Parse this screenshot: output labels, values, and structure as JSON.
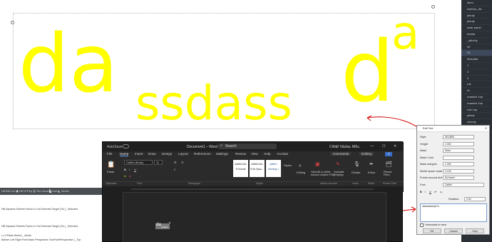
{
  "canvas": {
    "text_da": "da",
    "text_ssdass": "ssdass",
    "text_d": "d",
    "text_a": "a",
    "text_color": "#ffff00",
    "annotation_color": "#d40000"
  },
  "props_panel": {
    "items": [
      "dlom",
      "exterior_div",
      "pleuty",
      "plouty",
      "solar panel",
      "tomba",
      "_alluchy",
      "02",
      "03",
      "lenturkta",
      "1",
      "2",
      "3",
      "ruk",
      "rtt",
      "rmanice 1np",
      "rmanice 2np",
      "rcel 1np",
      "pilmar",
      "schody",
      "strop 1np",
      "strop 2np"
    ]
  },
  "command": {
    "toolbar": "Hill  Mil  Cm  ▣  Htl  Hl  Pep  ▤  Tex  Gsnd  ▙  Knrl  ◣  Vertex",
    "lines": [
      "Hill Dynamic Extents Factor In Out Selected Target (Tol ) _Selected",
      "Hill Dynamic Extents Factor In Out Selected Target (Tol ) _Selected",
      "x ) CPlane World ) _World",
      "Bottom Left Right Front Back Perspective TwoPointPerspective ) _Top"
    ]
  },
  "word": {
    "autosave": "AutoSave",
    "doc_title": "Document1 – Word",
    "search": "Search",
    "user": "Cihlář Václav, MSc.",
    "tabs": [
      "File",
      "Home",
      "Insert",
      "Draw",
      "Design",
      "Layout",
      "References",
      "Mailings",
      "Review",
      "View",
      "Help",
      "Acrobat"
    ],
    "comments": "Comments",
    "editing_mode": "Editing",
    "share": "↗",
    "paste": "Paste",
    "font_name": "Calibri (Body)",
    "font_size": "11",
    "styles": [
      {
        "preview": "AaBbCcDc",
        "name": "¶ Normal"
      },
      {
        "preview": "AaBbCcDc",
        "name": "¶ No Spac..."
      },
      {
        "preview": "AaBbC",
        "name": "Heading 1"
      }
    ],
    "styles_label": "Styles",
    "editing": "Editing",
    "create_pdf": "Vytvořit a sdílet\nsoubor Adobe PDF",
    "request_sign": "Vyžádat\npodpisy",
    "dictate": "Dictate",
    "editor": "Editor",
    "reuse_files": "Reuse\nFiles",
    "groups": [
      "Clipboard",
      "Font",
      "Paragraph",
      "Styles",
      "Adobe Acrobat",
      "Voice",
      "Editor",
      "Reuse Files"
    ],
    "doc_text_da": "da",
    "doc_text_sub": "ssdass",
    "doc_text_sup": "a"
  },
  "dialog": {
    "title": "Edit Text",
    "fields": [
      {
        "label": "Style",
        "value": "ARLBEK"
      },
      {
        "label": "Height",
        "value": "2.000"
      },
      {
        "label": "Mask",
        "value": "None"
      },
      {
        "label": "Mask Color",
        "value": ""
      },
      {
        "label": "Mask margins",
        "value": "1.000"
      },
      {
        "label": "Model space scale",
        "value": "0.100"
      },
      {
        "label": "Frame around text",
        "value": "No frame"
      },
      {
        "label": "Font",
        "value": "Calibri"
      }
    ],
    "format_buttons": [
      "B",
      "I",
      "U",
      "x²",
      "x₂"
    ],
    "rotation_label": "Rotation:",
    "rotation_value": "0.00",
    "text_value": "dasssdass|d^a",
    "horizontal_label": "Horizontal to view",
    "ok": "OK",
    "cancel": "Cancel",
    "help": "Help"
  }
}
